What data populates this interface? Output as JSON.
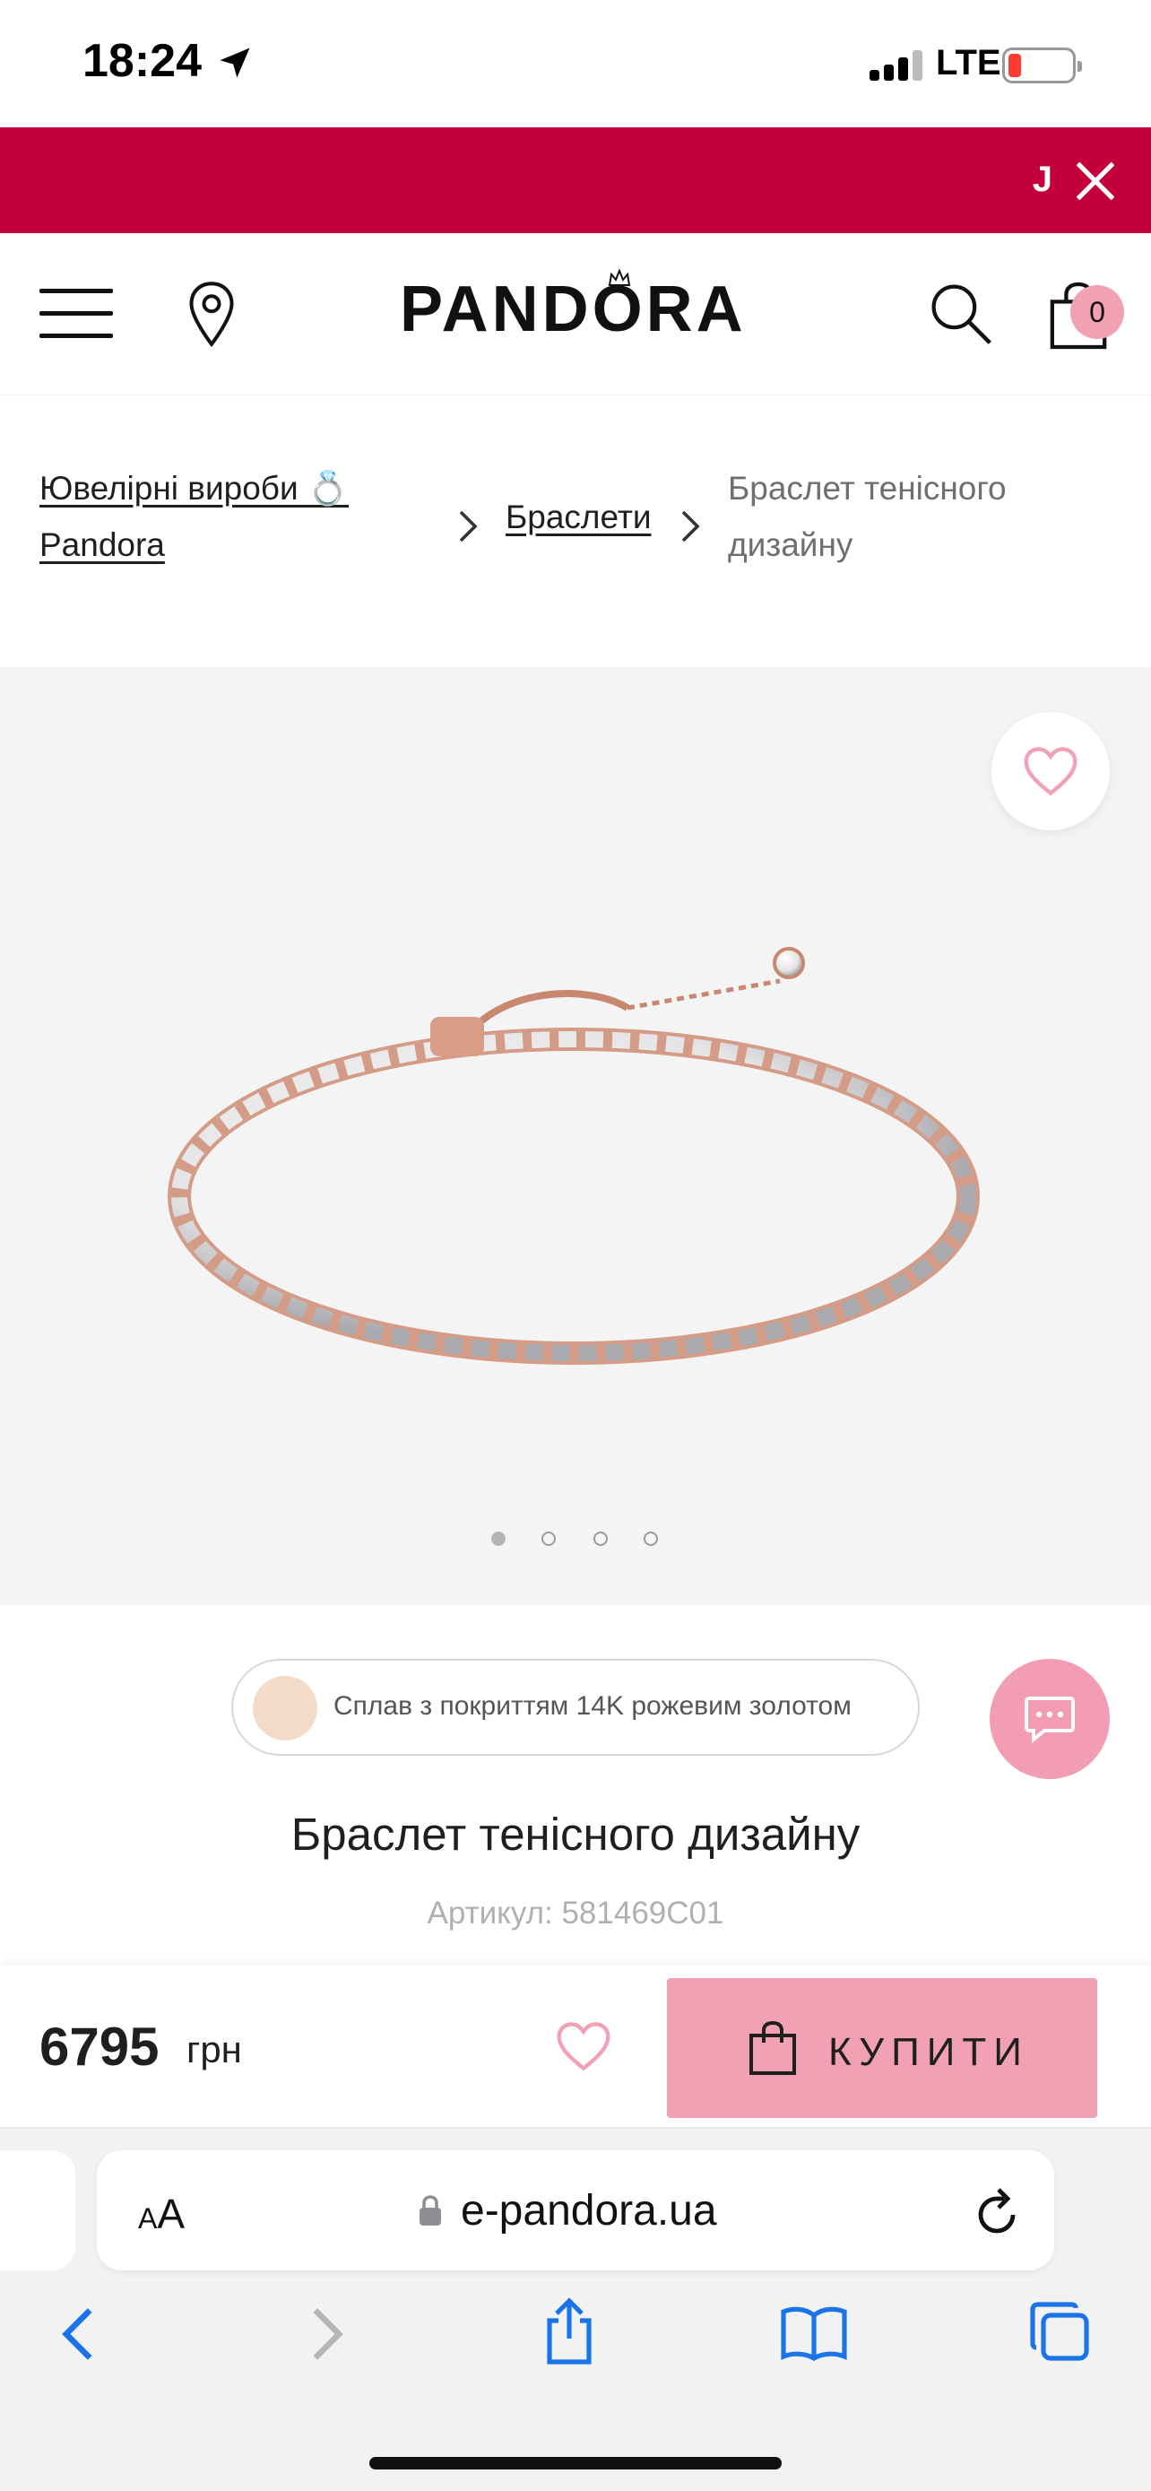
{
  "status_bar": {
    "time": "18:24",
    "network": "LTE"
  },
  "promo_banner": {
    "text": "J",
    "close_icon": "close-icon",
    "color": "#c4003c"
  },
  "header": {
    "logo": "PANDORA",
    "cart_count": "0"
  },
  "breadcrumb": {
    "items": [
      {
        "label": "Ювелірні вироби 💍 Pandora",
        "link": true
      },
      {
        "label": "Браслети",
        "link": true
      },
      {
        "label": "Браслет тенісного дизайну",
        "link": false
      }
    ]
  },
  "gallery": {
    "slides": 4,
    "active_slide": 1
  },
  "product": {
    "material": "Сплав з покриттям 14K рожевим золотом",
    "title": "Браслет тенісного дизайну",
    "sku": "Артикул: 581469C01",
    "price": "6795",
    "currency": "грн",
    "buy_label": "КУПИТИ",
    "accent_color": "#f2a0b4"
  },
  "safari": {
    "text_size": "AA",
    "url": "e-pandora.ua"
  }
}
